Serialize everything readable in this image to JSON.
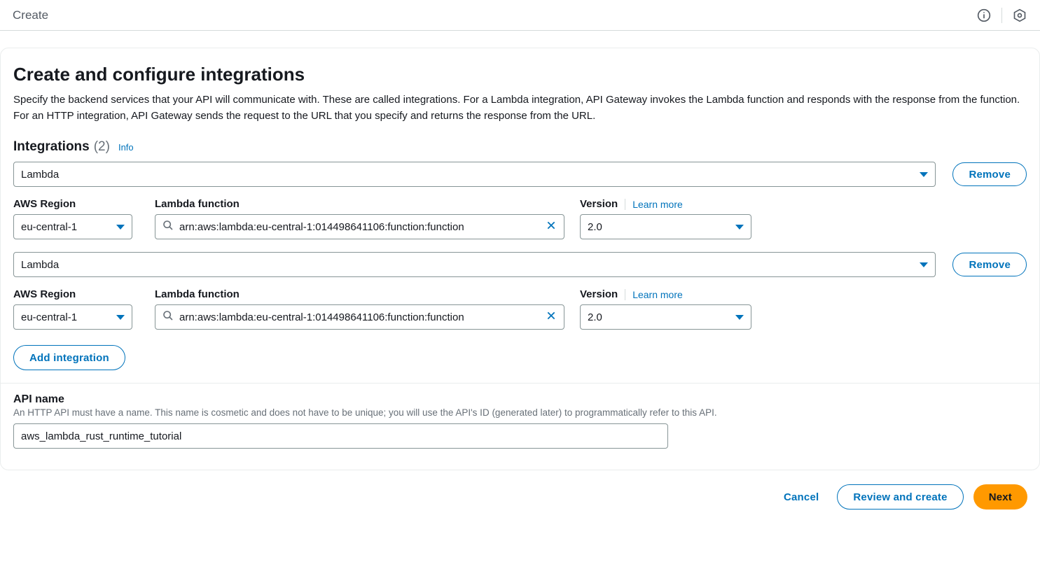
{
  "header": {
    "breadcrumb": "Create"
  },
  "panel": {
    "title": "Create and configure integrations",
    "description": "Specify the backend services that your API will communicate with. These are called integrations. For a Lambda integration, API Gateway invokes the Lambda function and responds with the response from the function. For an HTTP integration, API Gateway sends the request to the URL that you specify and returns the response from the URL."
  },
  "integrations_header": {
    "label": "Integrations",
    "count": "(2)",
    "info": "Info"
  },
  "labels": {
    "aws_region": "AWS Region",
    "lambda_function": "Lambda function",
    "version": "Version",
    "learn_more": "Learn more",
    "remove": "Remove",
    "add_integration": "Add integration",
    "api_name": "API name",
    "api_name_desc": "An HTTP API must have a name. This name is cosmetic and does not have to be unique; you will use the API's ID (generated later) to programmatically refer to this API."
  },
  "integrations": [
    {
      "type": "Lambda",
      "region": "eu-central-1",
      "fn_arn": "arn:aws:lambda:eu-central-1:014498641106:function:function",
      "version": "2.0"
    },
    {
      "type": "Lambda",
      "region": "eu-central-1",
      "fn_arn": "arn:aws:lambda:eu-central-1:014498641106:function:function",
      "version": "2.0"
    }
  ],
  "api_name_value": "aws_lambda_rust_runtime_tutorial",
  "footer": {
    "cancel": "Cancel",
    "review": "Review and create",
    "next": "Next"
  }
}
